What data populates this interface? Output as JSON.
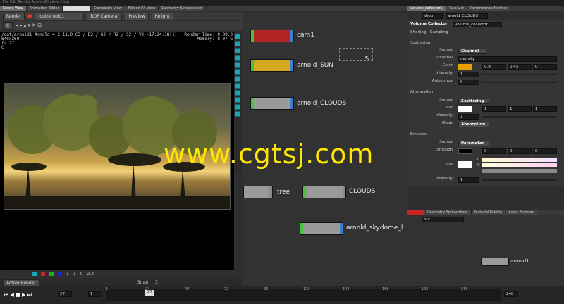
{
  "menubar": "File   Edit   Render   Assets   Windows   Help",
  "left_tabs": [
    {
      "label": "Scene View"
    },
    {
      "label": "Animation Editor"
    },
    {
      "label": "Composite View"
    },
    {
      "label": "Motion FX View"
    },
    {
      "label": "Geometry Spreadsheet"
    }
  ],
  "render": {
    "render_label": "Render",
    "path": "/out/arnold1",
    "camera": "ROP Camera",
    "preview": "Preview",
    "relight": "Relight",
    "info_line1": "/out/arnold1   Arnold 4.2.11.0   C3 / D2 / G2 / R2 / S2 / V2 -17:24:18[1]",
    "info_line2": "640x360",
    "info_line3": "fr 27",
    "info_line4": "C",
    "render_time": "Render Time: 0:00:0",
    "memory": "Memory:       8.07 G"
  },
  "status": {
    "val1": "1",
    "val2": "1",
    "val3": "0",
    "val4": "2.2"
  },
  "timeline": {
    "active_render": "Active Render",
    "frame": "27",
    "step": "1",
    "snap_label": "Snap",
    "snap": "3",
    "start": "1",
    "end": "240",
    "ticks": [
      "1",
      "24",
      "48",
      "72",
      "96",
      "120",
      "144",
      "168",
      "192",
      "216"
    ],
    "current": "27"
  },
  "network": {
    "nodes": [
      {
        "label": "cam1"
      },
      {
        "label": "arnold_SUN"
      },
      {
        "label": "arnold_CLOUDS"
      },
      {
        "label": "tree"
      },
      {
        "label": "CLOUDS"
      },
      {
        "label": "arnold_skydome_l"
      }
    ]
  },
  "right_tabs": [
    {
      "label": "volume_collector1"
    },
    {
      "label": "Take List"
    },
    {
      "label": "Performance Monitor"
    }
  ],
  "props": {
    "path_shop": "shop",
    "path_node": "arnold_CLOUDS",
    "node_type": "Volume Collector",
    "node_name": "volume_collector1",
    "subtabs": [
      "Shading",
      "Sampling"
    ],
    "scattering": "Scattering",
    "source_label": "Source",
    "source_val": "Channel",
    "channel_label": "Channel",
    "channel_val": "density",
    "color_label": "Color",
    "color_vals": [
      "0.9",
      "0.45",
      "0"
    ],
    "intensity_label": "Intensity",
    "intensity_val": "1",
    "anisotropy_label": "Anisotropy",
    "anisotropy_val": "0",
    "attenuation": "Attenuation",
    "att_source_val": "Scattering",
    "att_color_vals": [
      "1",
      "1",
      "1"
    ],
    "att_intensity_val": "1",
    "mode_label": "Mode",
    "mode_val": "Absorption",
    "emission": "Emission",
    "em_source_val": "Parameter",
    "emission_label": "Emission",
    "em_vals": [
      "0",
      "0",
      "0"
    ],
    "tmi": [
      "T",
      "M",
      "I"
    ],
    "em_intensity_val": "1"
  },
  "lower_right": {
    "tabs": [
      {
        "label": "Geometry Spreadsheet"
      },
      {
        "label": "Material Palette"
      },
      {
        "label": "Asset Browser"
      }
    ],
    "path": "out",
    "node": "arnold1"
  },
  "watermark": "www.cgtsj.com"
}
